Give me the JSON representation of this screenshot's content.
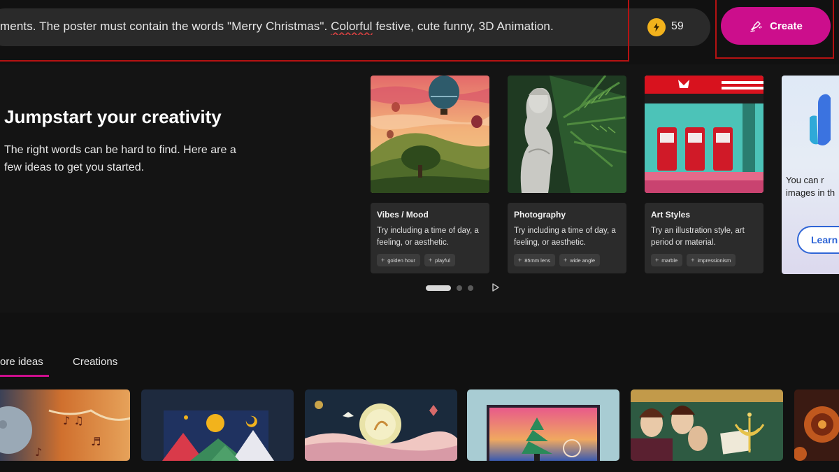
{
  "prompt": {
    "text_before": "ments. The poster must contain the words \"Merry Christmas\". ",
    "text_flagged": "Colorful",
    "text_after": " festive, cute funny, 3D Animation."
  },
  "boosts": {
    "count": "59"
  },
  "create_button": {
    "label": "Create"
  },
  "hero": {
    "title": "Jumpstart your creativity",
    "description": "The right words can be hard to find. Here are a few ideas to get you started."
  },
  "cards": [
    {
      "title": "Vibes / Mood",
      "description": "Try including a time of day, a feeling, or aesthetic.",
      "tags": [
        "golden hour",
        "playful"
      ]
    },
    {
      "title": "Photography",
      "description": "Try including a time of day, a feeling, or aesthetic.",
      "tags": [
        "85mm lens",
        "wide angle"
      ]
    },
    {
      "title": "Art Styles",
      "description": "Try an illustration style, art period or material.",
      "tags": [
        "marble",
        "impressionism"
      ]
    }
  ],
  "promo": {
    "line1": "You can r",
    "line2": "images in th",
    "button": "Learn"
  },
  "carousel": {
    "active_index": 0,
    "total": 3
  },
  "tabs": [
    {
      "label": "ore ideas",
      "active": true
    },
    {
      "label": "Creations",
      "active": false
    }
  ],
  "colors": {
    "accent": "#cc0e8c",
    "annotation_red": "#b51212",
    "coin": "#f2b21c"
  },
  "icons": [
    "bolt-icon",
    "create-icon",
    "plus-icon",
    "next-arrow-icon"
  ]
}
